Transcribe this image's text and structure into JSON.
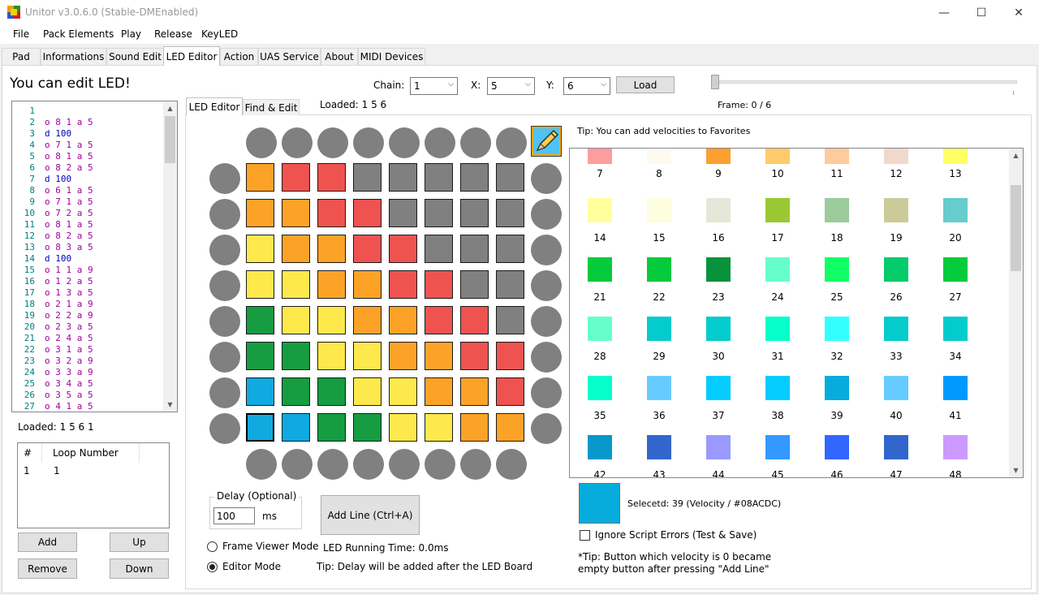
{
  "window": {
    "title": "Unitor v3.0.6.0 (Stable-DMEnabled)",
    "minimize_glyph": "—",
    "maximize_glyph": "☐",
    "close_glyph": "✕"
  },
  "menu": [
    "File",
    "Pack Elements",
    "Play",
    "Release",
    "KeyLED"
  ],
  "tabs": [
    "Pad",
    "Informations",
    "Sound Edit",
    "LED Editor",
    "Action",
    "UAS Service",
    "About",
    "MIDI Devices"
  ],
  "active_tab": "LED Editor",
  "heading": "You can edit LED!",
  "code_lines": [
    {
      "n": "1",
      "t": ""
    },
    {
      "n": "2",
      "t": "o 8 1 a 5"
    },
    {
      "n": "3",
      "t": "d 100"
    },
    {
      "n": "4",
      "t": "o 7 1 a 5"
    },
    {
      "n": "5",
      "t": "o 8 1 a 5"
    },
    {
      "n": "6",
      "t": "o 8 2 a 5"
    },
    {
      "n": "7",
      "t": "d 100"
    },
    {
      "n": "8",
      "t": "o 6 1 a 5"
    },
    {
      "n": "9",
      "t": "o 7 1 a 5"
    },
    {
      "n": "10",
      "t": "o 7 2 a 5"
    },
    {
      "n": "11",
      "t": "o 8 1 a 5"
    },
    {
      "n": "12",
      "t": "o 8 2 a 5"
    },
    {
      "n": "13",
      "t": "o 8 3 a 5"
    },
    {
      "n": "14",
      "t": "d 100"
    },
    {
      "n": "15",
      "t": "o 1 1 a 9"
    },
    {
      "n": "16",
      "t": "o 1 2 a 5"
    },
    {
      "n": "17",
      "t": "o 1 3 a 5"
    },
    {
      "n": "18",
      "t": "o 2 1 a 9"
    },
    {
      "n": "19",
      "t": "o 2 2 a 9"
    },
    {
      "n": "20",
      "t": "o 2 3 a 5"
    },
    {
      "n": "21",
      "t": "o 2 4 a 5"
    },
    {
      "n": "22",
      "t": "o 3 1 a 5"
    },
    {
      "n": "23",
      "t": "o 3 2 a 9"
    },
    {
      "n": "24",
      "t": "o 3 3 a 9"
    },
    {
      "n": "25",
      "t": "o 3 4 a 5"
    },
    {
      "n": "26",
      "t": "o 3 5 a 5"
    },
    {
      "n": "27",
      "t": "o 4 1 a 5"
    }
  ],
  "code_colors": {
    "number": "#008080",
    "command": "#a000a0",
    "delay": "#0000c0"
  },
  "loaded_left": "Loaded: 1 5 6 1",
  "loop_list": {
    "headers": [
      "#",
      "Loop Number"
    ],
    "rows": [
      [
        "1",
        "1"
      ]
    ]
  },
  "buttons": {
    "add": "Add",
    "up": "Up",
    "remove": "Remove",
    "down": "Down",
    "load": "Load",
    "add_line": "Add Line (Ctrl+A)"
  },
  "chain": {
    "label": "Chain:",
    "value": "1"
  },
  "x": {
    "label": "X:",
    "value": "5"
  },
  "y": {
    "label": "Y:",
    "value": "6"
  },
  "frame_label": "Frame: 0 / 6",
  "frame_slider_value": 0,
  "inner_tabs": [
    "LED Editor",
    "Find & Edit"
  ],
  "loaded_inner": "Loaded: 1 5 6",
  "tip_favorites": "Tip: You can add velocities to Favorites",
  "board": {
    "colors": {
      "O": "#fca327",
      "R": "#ef5350",
      "G": "#808080",
      "Y": "#fde94c",
      "D": "#169c41",
      "B": "#10a9e0"
    },
    "grid": [
      "ORRGGGGG",
      "OORRGGGG",
      "YOORRGGG",
      "YYOORRGG",
      "DYYOORRG",
      "DDYYOORR",
      "BDDYYOOR",
      "BBDDYYOO"
    ],
    "selected_cell": [
      7,
      0
    ],
    "side_circle_color": "#808080",
    "pencil_icon": "pencil-icon"
  },
  "delay": {
    "legend": "Delay (Optional)",
    "value": "100",
    "unit": "ms"
  },
  "modes": [
    {
      "label": "Frame Viewer Mode",
      "checked": false
    },
    {
      "label": "Editor Mode",
      "checked": true
    }
  ],
  "led_running_time": "LED Running Time: 0.0ms",
  "tip_delay": "Tip: Delay will be added after the LED Board",
  "palette": [
    {
      "v": "7",
      "c": "#fe9d9d"
    },
    {
      "v": "8",
      "c": "#fefaf0"
    },
    {
      "v": "9",
      "c": "#fd9f2f"
    },
    {
      "v": "10",
      "c": "#ffca6a"
    },
    {
      "v": "11",
      "c": "#fecb9a"
    },
    {
      "v": "12",
      "c": "#f0d9cb"
    },
    {
      "v": "13",
      "c": "#ffff66"
    },
    {
      "v": "14",
      "c": "#ffff9c"
    },
    {
      "v": "15",
      "c": "#fdfde0"
    },
    {
      "v": "16",
      "c": "#e6e6d8"
    },
    {
      "v": "17",
      "c": "#9ac832"
    },
    {
      "v": "18",
      "c": "#9ccc9c"
    },
    {
      "v": "19",
      "c": "#cbcb9a"
    },
    {
      "v": "20",
      "c": "#66cccc"
    },
    {
      "v": "21",
      "c": "#05cb3c"
    },
    {
      "v": "22",
      "c": "#05cb3c"
    },
    {
      "v": "23",
      "c": "#08923c"
    },
    {
      "v": "24",
      "c": "#66ffcc"
    },
    {
      "v": "25",
      "c": "#11ff66"
    },
    {
      "v": "26",
      "c": "#05cb6b"
    },
    {
      "v": "27",
      "c": "#04cc3d"
    },
    {
      "v": "28",
      "c": "#66ffcc"
    },
    {
      "v": "29",
      "c": "#05cccc"
    },
    {
      "v": "30",
      "c": "#05cccc"
    },
    {
      "v": "31",
      "c": "#05ffcc"
    },
    {
      "v": "32",
      "c": "#33ffff"
    },
    {
      "v": "33",
      "c": "#05cccc"
    },
    {
      "v": "34",
      "c": "#05cccc"
    },
    {
      "v": "35",
      "c": "#05ffcc"
    },
    {
      "v": "36",
      "c": "#66ccff"
    },
    {
      "v": "37",
      "c": "#05ccff"
    },
    {
      "v": "38",
      "c": "#05ccff"
    },
    {
      "v": "39",
      "c": "#08acdc"
    },
    {
      "v": "40",
      "c": "#66ccff"
    },
    {
      "v": "41",
      "c": "#0099ff"
    },
    {
      "v": "42",
      "c": "#0898cc"
    },
    {
      "v": "43",
      "c": "#3366cc"
    },
    {
      "v": "44",
      "c": "#9999ff"
    },
    {
      "v": "45",
      "c": "#3399ff"
    },
    {
      "v": "46",
      "c": "#3366ff"
    },
    {
      "v": "47",
      "c": "#3366cc"
    },
    {
      "v": "48",
      "c": "#cc99ff"
    }
  ],
  "selected_color": "#08acdc",
  "selected_text": "Selecetd: 39 (Velocity / #08ACDC)",
  "ignore_errors": "Ignore Script Errors (Test & Save)",
  "tip_button_line1": "*Tip: Button which velocity is 0 became",
  "tip_button_line2": "empty button after pressing \"Add Line\""
}
